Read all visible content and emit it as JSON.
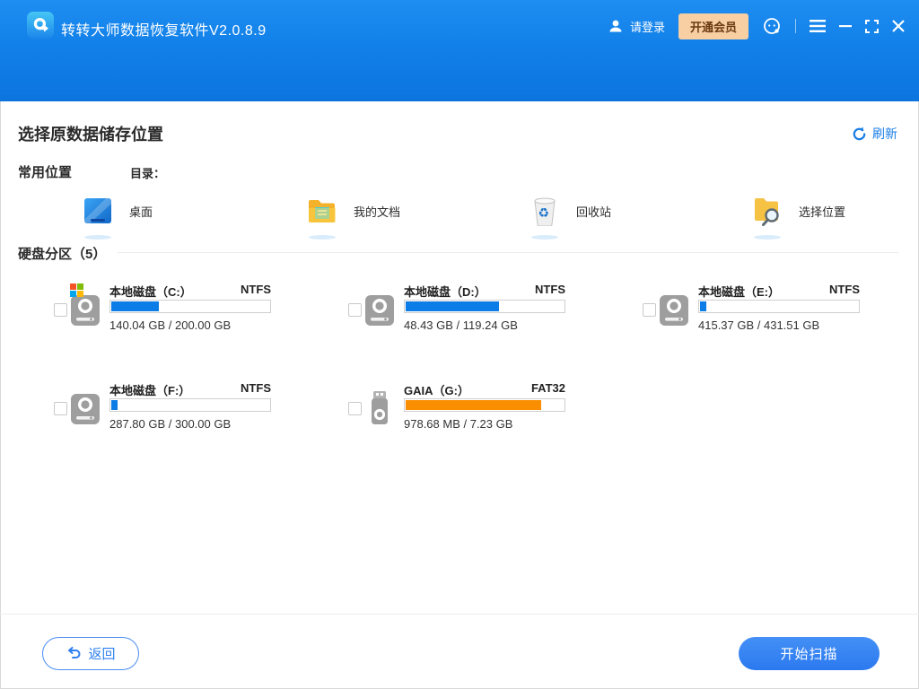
{
  "titlebar": {
    "app_title": "转转大师数据恢复软件V2.0.8.9",
    "login_label": "请登录",
    "vip_label": "开通会员"
  },
  "page": {
    "title": "选择原数据储存位置",
    "refresh_label": "刷新"
  },
  "common": {
    "heading": "常用位置",
    "directory_label": "目录：",
    "items": [
      {
        "label": "桌面",
        "icon": "desktop-icon"
      },
      {
        "label": "我的文档",
        "icon": "documents-folder-icon"
      },
      {
        "label": "回收站",
        "icon": "recycle-bin-icon"
      },
      {
        "label": "选择位置",
        "icon": "choose-location-icon"
      }
    ]
  },
  "partitions": {
    "heading": "硬盘分区（5）",
    "disks": [
      {
        "name": "本地磁盘（C:）",
        "fs": "NTFS",
        "size": "140.04 GB / 200.00 GB",
        "used_percent": 30,
        "bar_color": "#0c7ce6",
        "device": "hdd-windows"
      },
      {
        "name": "本地磁盘（D:）",
        "fs": "NTFS",
        "size": "48.43 GB / 119.24 GB",
        "used_percent": 59,
        "bar_color": "#0c7ce6",
        "device": "hdd"
      },
      {
        "name": "本地磁盘（E:）",
        "fs": "NTFS",
        "size": "415.37 GB / 431.51 GB",
        "used_percent": 4,
        "bar_color": "#0c7ce6",
        "device": "hdd"
      },
      {
        "name": "本地磁盘（F:）",
        "fs": "NTFS",
        "size": "287.80 GB / 300.00 GB",
        "used_percent": 4,
        "bar_color": "#0c7ce6",
        "device": "hdd"
      },
      {
        "name": "GAIA（G:）",
        "fs": "FAT32",
        "size": "978.68 MB / 7.23 GB",
        "used_percent": 86,
        "bar_color": "#f98f00",
        "device": "usb"
      }
    ]
  },
  "footer": {
    "back_label": "返回",
    "scan_label": "开始扫描"
  },
  "colors": {
    "accent_blue": "#1a7ee6",
    "bar_blue": "#0c7ce6",
    "bar_orange": "#f98f00",
    "vip_bg": "#f7cfa2",
    "vip_text": "#6b3a10",
    "header_top": "#1f8ef2",
    "header_bottom": "#0d74de"
  }
}
